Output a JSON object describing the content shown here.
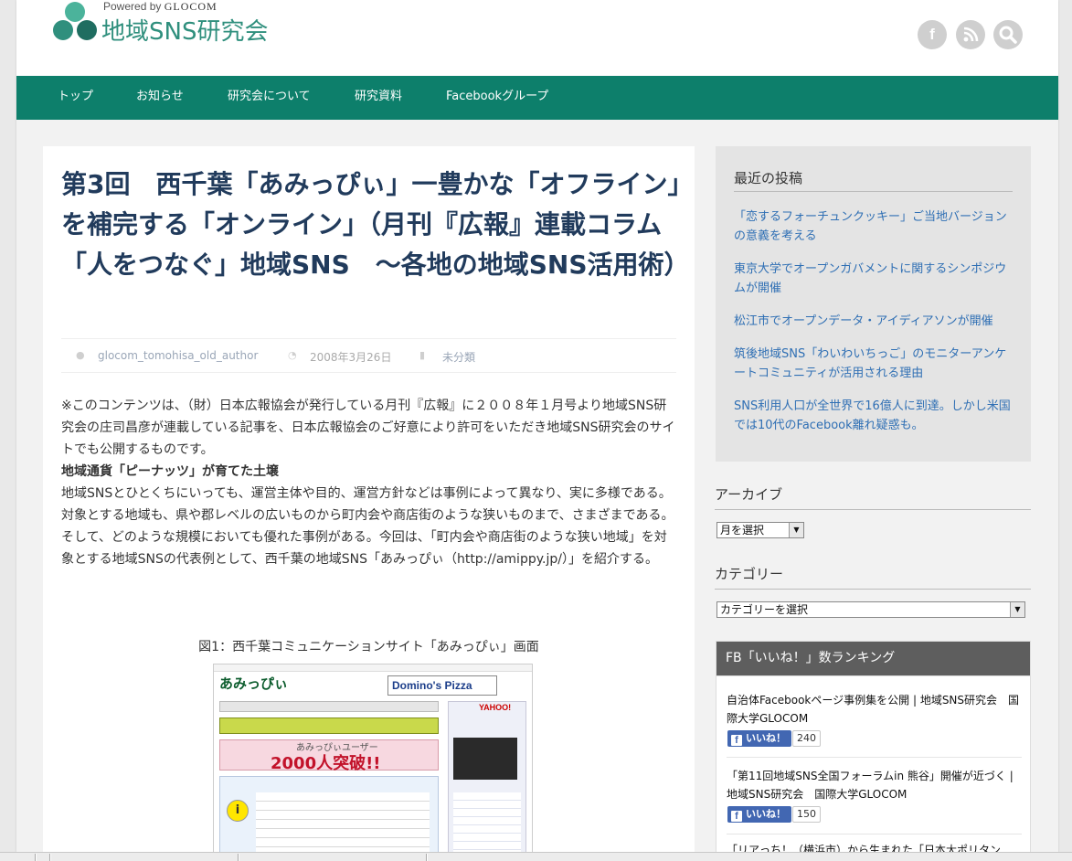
{
  "site": {
    "powered_by_prefix": "Powered by",
    "powered_by_brand": "GLOCOM",
    "title": "地域SNS研究会",
    "logo_colors": [
      "#2f8f7d",
      "#4bb39b",
      "#1f6d60"
    ]
  },
  "social": {
    "facebook": "f",
    "rss": "rss-icon",
    "search": "search-icon"
  },
  "nav": {
    "items": [
      "トップ",
      "お知らせ",
      "研究会について",
      "研究資料",
      "Facebookグループ"
    ],
    "color": "#0d7f6b"
  },
  "article": {
    "title": "第3回　西千葉「あみっぴぃ」一豊かな「オフライン」を補完する「オンライン」（月刊『広報』連載コラム　「人をつなぐ」地域SNS　～各地の地域SNS活用術）",
    "author": "glocom_tomohisa_old_author",
    "date": "2008年3月26日",
    "category": "未分類",
    "intro": "※このコンテンツは、（財）日本広報協会が発行している月刊『広報』に２００８年１月号より地域SNS研究会の庄司昌彦が連載している記事を、日本広報協会のご好意により許可をいただき地域SNS研究会のサイトでも公開するものです。",
    "heading": "地域通貨「ピーナッツ」が育てた土壌",
    "paragraph": "地域SNSとひとくちにいっても、運営主体や目的、運営方針などは事例によって異なり、実に多様である。対象とする地域も、県や郡レベルの広いものから町内会や商店街のような狭いものまで、さまざまである。そして、どのような規模においても優れた事例がある。今回は、「町内会や商店街のような狭い地域」を対象とする地域SNSの代表例として、西千葉の地域SNS「あみっぴぃ（http://amippy.jp/）」を紹介する。",
    "figure_caption": "図1：西千葉コミュニケーションサイト「あみっぴぃ」画面"
  },
  "figure": {
    "logo_text": "あみっぴぃ",
    "dominos": "Domino's Pizza",
    "banner": "あみっぴぃユーザー",
    "milestone": "2000人突破!!",
    "yahoo": "YAHOO!"
  },
  "sidebar": {
    "recent_title": "最近の投稿",
    "recent_posts": [
      "「恋するフォーチュンクッキー」ご当地バージョンの意義を考える",
      "東京大学でオープンガバメントに関するシンポジウムが開催",
      "松江市でオープンデータ・アイディアソンが開催",
      "筑後地域SNS「わいわいちっご」のモニターアンケートコミュニティが活用される理由",
      "SNS利用人口が全世界で16億人に到達。しかし米国では10代のFacebook離れ疑惑も。"
    ],
    "archive_title": "アーカイブ",
    "archive_select": "月を選択",
    "category_title": "カテゴリー",
    "category_select": "カテゴリーを選択",
    "fb_title": "FB「いいね！」数ランキング",
    "fb_items": [
      {
        "title": "自治体Facebookページ事例集を公開 | 地域SNS研究会　国際大学GLOCOM",
        "like": "いいね！",
        "count": "240"
      },
      {
        "title": "「第11回地域SNS全国フォーラムin 熊谷」開催が近づく | 地域SNS研究会　国際大学GLOCOM",
        "like": "いいね！",
        "count": "150"
      },
      {
        "title": "「リアっち！（横浜市）から生まれた「日本大ポリタン",
        "like": "",
        "count": ""
      }
    ]
  }
}
